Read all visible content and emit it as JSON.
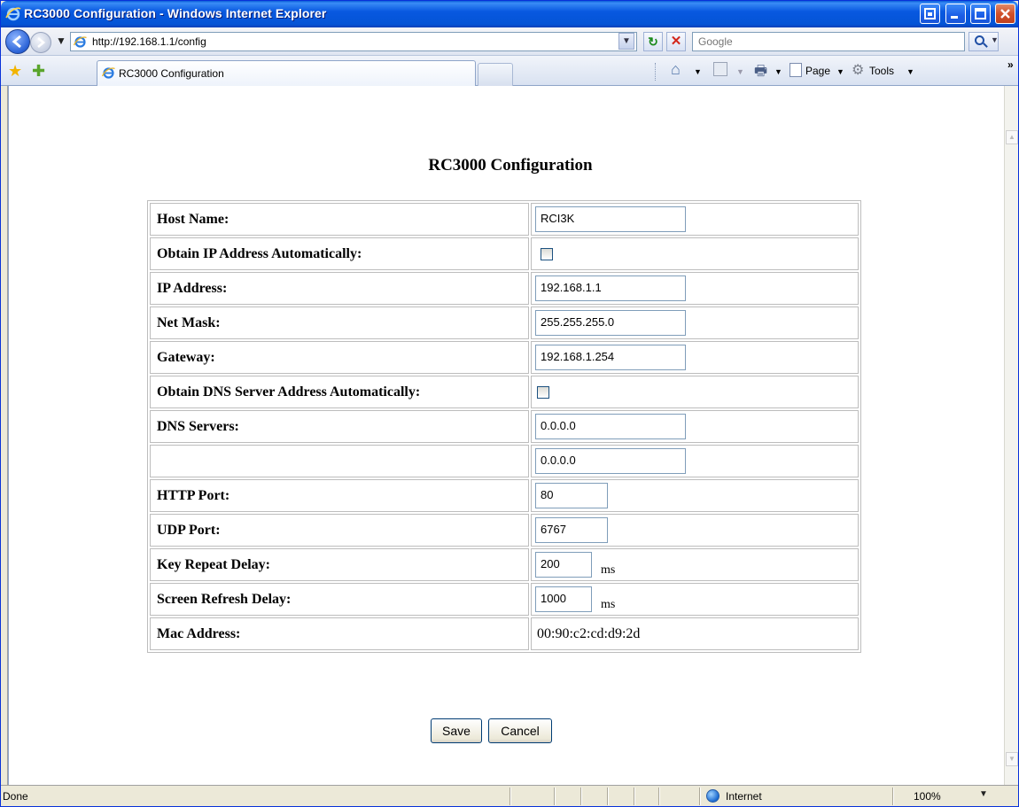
{
  "window": {
    "title": "RC3000 Configuration - Windows Internet Explorer"
  },
  "addressbar": {
    "url": "http://192.168.1.1/config",
    "search_placeholder": "Google"
  },
  "tabs": {
    "active_label": "RC3000 Configuration"
  },
  "commandbar": {
    "page_label": "Page",
    "tools_label": "Tools",
    "overflow": "»"
  },
  "page": {
    "heading": "RC3000 Configuration",
    "fields": {
      "host_name": {
        "label": "Host Name:",
        "value": "RCI3K"
      },
      "obtain_ip": {
        "label": "Obtain IP Address Automatically:",
        "checked": false
      },
      "ip_address": {
        "label": "IP Address:",
        "value": "192.168.1.1"
      },
      "net_mask": {
        "label": "Net Mask:",
        "value": "255.255.255.0"
      },
      "gateway": {
        "label": "Gateway:",
        "value": "192.168.1.254"
      },
      "obtain_dns": {
        "label": "Obtain DNS Server Address Automatically:",
        "checked": false
      },
      "dns_servers": {
        "label": "DNS Servers:",
        "primary": "0.0.0.0",
        "secondary": "0.0.0.0"
      },
      "http_port": {
        "label": "HTTP Port:",
        "value": "80"
      },
      "udp_port": {
        "label": "UDP Port:",
        "value": "6767"
      },
      "key_repeat_delay": {
        "label": "Key Repeat Delay:",
        "value": "200",
        "unit": "ms"
      },
      "screen_refresh_delay": {
        "label": "Screen Refresh Delay:",
        "value": "1000",
        "unit": "ms"
      },
      "mac_address": {
        "label": "Mac Address:",
        "value": "00:90:c2:cd:d9:2d"
      }
    },
    "buttons": {
      "save": "Save",
      "cancel": "Cancel"
    }
  },
  "statusbar": {
    "status": "Done",
    "zone": "Internet",
    "zoom": "100%"
  },
  "colors": {
    "titlebar": "#0454d6",
    "close_button": "#d1502a",
    "chrome": "#ece9d8"
  }
}
